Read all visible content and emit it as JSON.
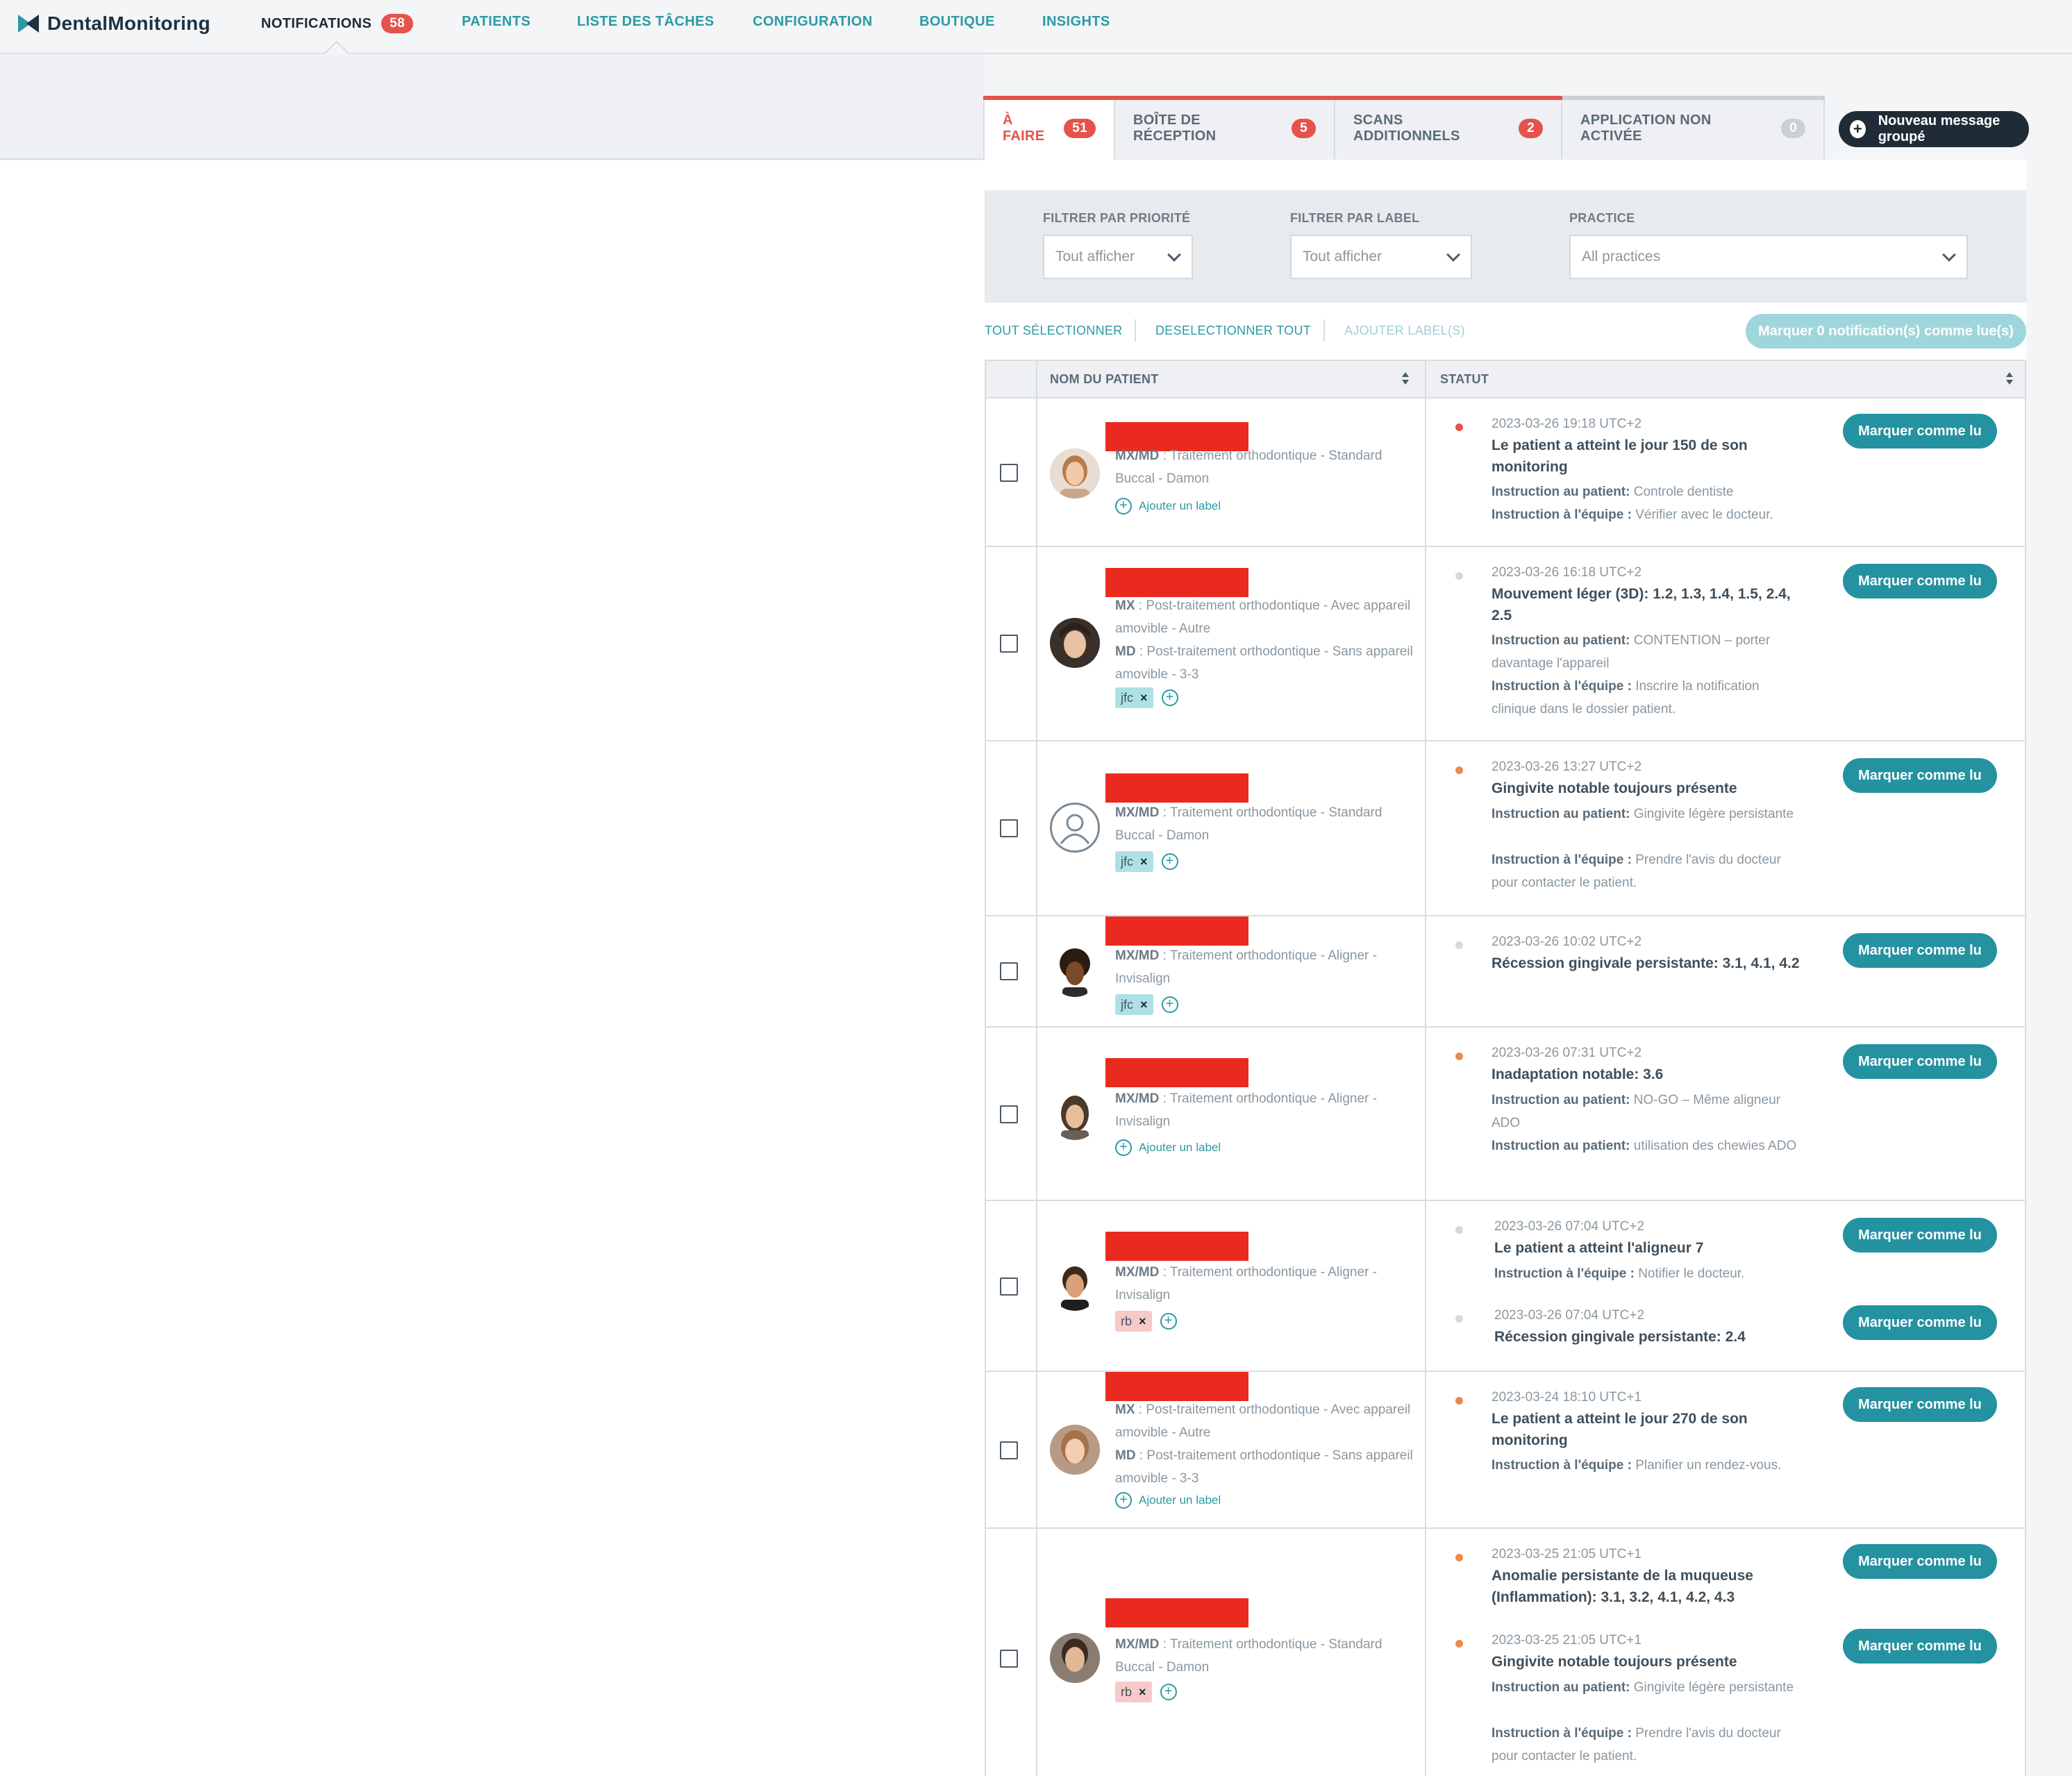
{
  "brand": {
    "name": "DentalMonitoring",
    "accent": "#2a9aa4",
    "alert": "#e5534b",
    "dark": "#1f2b36"
  },
  "nav": [
    {
      "label": "NOTIFICATIONS",
      "badge": "58",
      "active": true
    },
    {
      "label": "PATIENTS"
    },
    {
      "label": "LISTE DES TÂCHES"
    },
    {
      "label": "CONFIGURATION"
    },
    {
      "label": "BOUTIQUE"
    },
    {
      "label": "INSIGHTS"
    }
  ],
  "tabs": [
    {
      "label": "À FAIRE",
      "badge": "51",
      "active": true
    },
    {
      "label": "BOÎTE DE RÉCEPTION",
      "badge": "5"
    },
    {
      "label": "SCANS ADDITIONNELS",
      "badge": "2"
    },
    {
      "label": "APPLICATION NON ACTIVÉE",
      "badge": "0"
    }
  ],
  "new_message_label": "Nouveau message groupé",
  "filters": {
    "priority": {
      "label": "FILTRER PAR PRIORITÉ",
      "value": "Tout afficher"
    },
    "label": {
      "label": "FILTRER PAR LABEL",
      "value": "Tout afficher"
    },
    "practice": {
      "label": "PRACTICE",
      "value": "All practices"
    }
  },
  "actions": {
    "select_all": "TOUT SÉLECTIONNER",
    "deselect_all": "DESELECTIONNER TOUT",
    "add_labels": "AJOUTER LABEL(S)",
    "mark_read": "Marquer 0 notification(s) comme lue(s)"
  },
  "table": {
    "col_patient": "NOM DU PATIENT",
    "col_status": "STATUT"
  },
  "common": {
    "add_label": "Ajouter un label",
    "mark_button": "Marquer comme lu",
    "remove": "×"
  },
  "rows": [
    {
      "p1_key": "MX/MD",
      "p1_val": " : Traitement orthodontique - Standard Buccal - Damon",
      "tag": "",
      "n1": {
        "date": "2023-03-26 19:18 UTC+2",
        "title": "Le patient a atteint le jour 150 de son monitoring",
        "i1_key": "Instruction au patient:",
        "i1_val": " Controle dentiste",
        "i2_key": "Instruction à l'équipe :",
        "i2_val": " Vérifier avec le docteur."
      }
    },
    {
      "p1_key": "MX",
      "p1_val": " : Post-traitement orthodontique - Avec appareil amovible - Autre",
      "p2_key": "MD",
      "p2_val": " : Post-traitement orthodontique - Sans appareil amovible - 3-3",
      "tag": "jfc",
      "n1": {
        "date": "2023-03-26 16:18 UTC+2",
        "title": "Mouvement léger (3D): 1.2, 1.3, 1.4, 1.5, 2.4, 2.5",
        "i1_key": "Instruction au patient:",
        "i1_val": " CONTENTION – porter davantage l'appareil",
        "i2_key": "Instruction à l'équipe :",
        "i2_val": " Inscrire la notification clinique dans le dossier patient."
      }
    },
    {
      "p1_key": "MX/MD",
      "p1_val": " : Traitement orthodontique - Standard Buccal - Damon",
      "tag": "jfc",
      "n1": {
        "date": "2023-03-26 13:27 UTC+2",
        "title": "Gingivite notable toujours présente",
        "i1_key": "Instruction au patient:",
        "i1_val": " Gingivite légère persistante",
        "i2_key": "Instruction à l'équipe :",
        "i2_val": " Prendre l'avis du docteur pour contacter le patient."
      }
    },
    {
      "p1_key": "MX/MD",
      "p1_val": " : Traitement orthodontique - Aligner - Invisalign",
      "tag": "jfc",
      "n1": {
        "date": "2023-03-26 10:02 UTC+2",
        "title": "Récession gingivale persistante: 3.1, 4.1, 4.2"
      }
    },
    {
      "p1_key": "MX/MD",
      "p1_val": " : Traitement orthodontique - Aligner - Invisalign",
      "tag": "",
      "n1": {
        "date": "2023-03-26 07:31 UTC+2",
        "title": "Inadaptation notable: 3.6",
        "i1_key": "Instruction au patient:",
        "i1_val": " NO-GO – Même aligneur ADO",
        "i2_key": "Instruction au patient:",
        "i2_val": " utilisation des chewies ADO"
      }
    },
    {
      "p1_key": "MX/MD",
      "p1_val": " : Traitement orthodontique - Aligner - Invisalign",
      "tag": "rb",
      "n1": {
        "date": "2023-03-26 07:04 UTC+2",
        "title": "Le patient a atteint l'aligneur 7",
        "i1_key": "Instruction à l'équipe :",
        "i1_val": " Notifier le docteur."
      },
      "n2": {
        "date": "2023-03-26 07:04 UTC+2",
        "title": "Récession gingivale persistante: 2.4"
      }
    },
    {
      "p1_key": "MX",
      "p1_val": " : Post-traitement orthodontique - Avec appareil amovible - Autre",
      "p2_key": "MD",
      "p2_val": " : Post-traitement orthodontique - Sans appareil amovible - 3-3",
      "tag": "",
      "n1": {
        "date": "2023-03-24 18:10 UTC+1",
        "title": "Le patient a atteint le jour 270 de son monitoring",
        "i1_key": "Instruction à l'équipe :",
        "i1_val": " Planifier un rendez-vous."
      }
    },
    {
      "p1_key": "MX/MD",
      "p1_val": " : Traitement orthodontique - Standard Buccal - Damon",
      "tag": "rb",
      "n1": {
        "date": "2023-03-25 21:05 UTC+1",
        "title": "Anomalie persistante de la muqueuse (Inflammation): 3.1, 3.2, 4.1, 4.2, 4.3"
      },
      "n2": {
        "date": "2023-03-25 21:05 UTC+1",
        "title": "Gingivite notable toujours présente",
        "i1_key": "Instruction au patient:",
        "i1_val": " Gingivite légère persistante",
        "i2_key": "Instruction à l'équipe :",
        "i2_val": " Prendre l'avis du docteur pour contacter le patient."
      }
    }
  ]
}
